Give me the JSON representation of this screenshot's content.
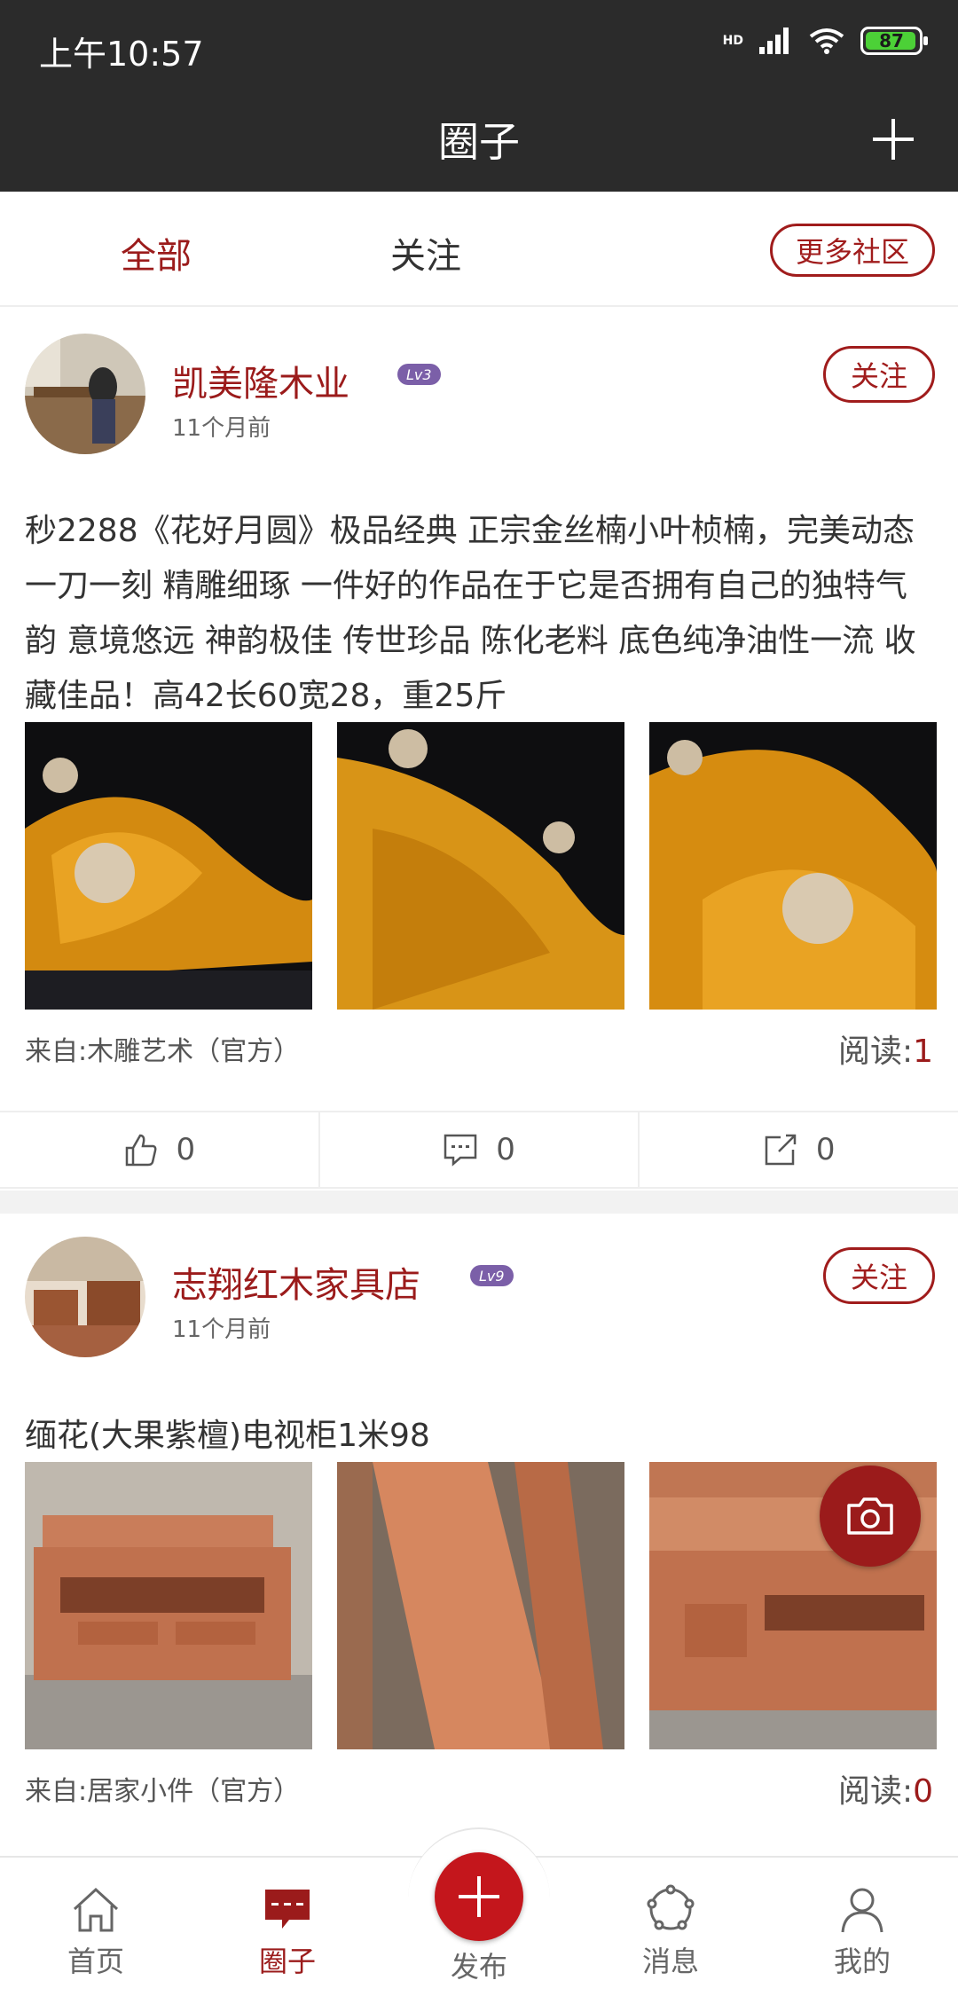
{
  "status_bar": {
    "time": "上午10:57",
    "hd": "HD",
    "battery": "87"
  },
  "header": {
    "title": "圈子",
    "add_icon": "plus-icon"
  },
  "tabs": [
    {
      "label": "全部",
      "active": true
    },
    {
      "label": "关注",
      "active": false
    }
  ],
  "more_communities": "更多社区",
  "posts": [
    {
      "author": "凯美隆木业",
      "level": "Lv3",
      "time": "11个月前",
      "follow": "关注",
      "text": "秒2288《花好月圆》极品经典 正宗金丝楠小叶桢楠，完美动态 一刀一刻 精雕细琢 一件好的作品在于它是否拥有自己的独特气韵 意境悠远 神韵极佳 传世珍品 陈化老料 底色纯净油性一流 收藏佳品！高42长60宽28，重25斤",
      "source": "来自:木雕艺术（官方）",
      "reads_label": "阅读:",
      "reads": "1",
      "likes": "0",
      "comments": "0",
      "shares": "0"
    },
    {
      "author": "志翔红木家具店",
      "level": "Lv9",
      "time": "11个月前",
      "follow": "关注",
      "text": "缅花(大果紫檀)电视柜1米98",
      "source": "来自:居家小件（官方）",
      "reads_label": "阅读:",
      "reads": "0"
    }
  ],
  "bottom_nav": [
    {
      "label": "首页",
      "icon": "home-icon"
    },
    {
      "label": "圈子",
      "icon": "circle-chat-icon",
      "active": true
    },
    {
      "label": "发布",
      "icon": "plus-icon"
    },
    {
      "label": "消息",
      "icon": "message-icon"
    },
    {
      "label": "我的",
      "icon": "user-icon"
    }
  ],
  "colors": {
    "accent": "#9b1b1b",
    "bar": "#2b2b2b"
  }
}
